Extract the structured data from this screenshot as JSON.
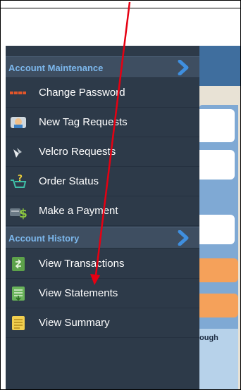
{
  "menu": {
    "sections": [
      {
        "header": "Account Maintenance",
        "items": [
          {
            "label": "Change Password",
            "icon": "password-dots-icon"
          },
          {
            "label": "New Tag Requests",
            "icon": "tag-request-icon"
          },
          {
            "label": "Velcro Requests",
            "icon": "velcro-icon"
          },
          {
            "label": "Order Status",
            "icon": "cart-question-icon"
          },
          {
            "label": "Make a Payment",
            "icon": "money-card-icon"
          }
        ]
      },
      {
        "header": "Account History",
        "items": [
          {
            "label": "View Transactions",
            "icon": "transactions-icon"
          },
          {
            "label": "View Statements",
            "icon": "statements-icon"
          },
          {
            "label": "View Summary",
            "icon": "summary-icon"
          }
        ]
      }
    ]
  },
  "right_pane": {
    "partial_text": "ough"
  },
  "colors": {
    "section_header_text": "#7cb7ec",
    "accent_arrow": "#e60012"
  }
}
